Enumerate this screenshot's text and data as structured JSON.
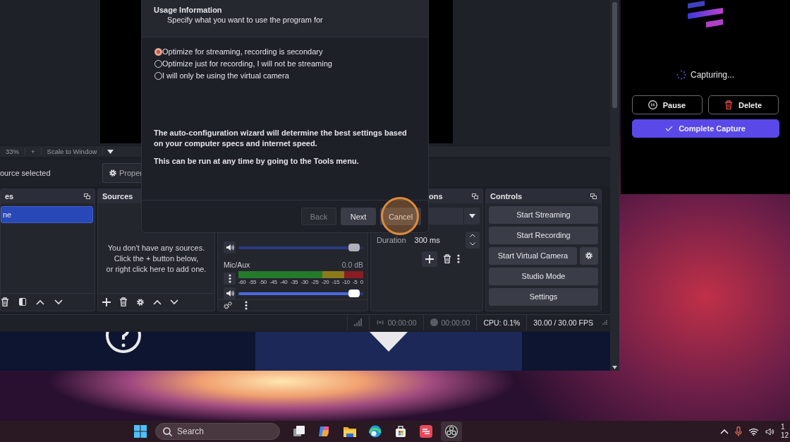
{
  "obs": {
    "preview_bar": {
      "zoom": "33%",
      "plus": "+",
      "scale": "Scale to Window"
    },
    "source_toolbar": {
      "label": "ource selected",
      "properties": "Proper"
    },
    "scenes": {
      "title": "es",
      "items": [
        {
          "name": "ne",
          "selected": true
        }
      ]
    },
    "sources": {
      "title": "Sources",
      "empty_lines": [
        "You don't have any sources.",
        "Click the + button below,",
        "or right click here to add one."
      ]
    },
    "audio_mixer": {
      "tracks": [
        {
          "kind": "slider",
          "level": 0.97,
          "disabled": true
        },
        {
          "kind": "meter",
          "name": "Mic/Aux",
          "reading": "0.0 dB",
          "ticks": [
            "-60",
            "-55",
            "-50",
            "-45",
            "-40",
            "-35",
            "-30",
            "-25",
            "-20",
            "-15",
            "-10",
            "-5",
            "0"
          ],
          "level": 0.97,
          "disabled": false
        }
      ]
    },
    "transitions": {
      "title": "ons",
      "duration_label": "Duration",
      "duration": "300 ms"
    },
    "controls": {
      "title": "Controls",
      "buttons": [
        {
          "label": "Start Streaming",
          "kind": "plain"
        },
        {
          "label": "Start Recording",
          "kind": "plain"
        },
        {
          "label": "Start Virtual Camera",
          "kind": "with-settings"
        },
        {
          "label": "Studio Mode",
          "kind": "plain"
        },
        {
          "label": "Settings",
          "kind": "plain"
        }
      ]
    },
    "status_bar": {
      "stream_time": "00:00:00",
      "record_time": "00:00:00",
      "cpu": "CPU: 0.1%",
      "fps": "30.00 / 30.00 FPS"
    }
  },
  "dialog": {
    "title": "Usage Information",
    "subtitle": "Specify what you want to use the program for",
    "options": [
      {
        "label": "Optimize for streaming, recording is secondary",
        "selected": true
      },
      {
        "label": "Optimize just for recording, I will not be streaming",
        "selected": false
      },
      {
        "label": "I will only be using the virtual camera",
        "selected": false
      }
    ],
    "notes": [
      "The auto-configuration wizard will determine the best settings based on your computer specs and internet speed.",
      "This can be run at any time by going to the Tools menu."
    ],
    "buttons": [
      {
        "label": "Back",
        "disabled": true,
        "highlighted": false
      },
      {
        "label": "Next",
        "disabled": false,
        "highlighted": false
      },
      {
        "label": "Cancel",
        "disabled": false,
        "highlighted": true
      }
    ]
  },
  "capture_panel": {
    "status": "Capturing...",
    "buttons": [
      {
        "label": "Pause",
        "kind": "pause"
      },
      {
        "label": "Delete",
        "kind": "delete"
      },
      {
        "label": "Complete Capture",
        "kind": "complete"
      }
    ]
  },
  "taskbar": {
    "search": {
      "placeholder": "Search"
    },
    "apps": [
      {
        "kind": "task-view",
        "selected": false
      },
      {
        "kind": "copilot",
        "selected": false
      },
      {
        "kind": "folder",
        "selected": false
      },
      {
        "kind": "edge",
        "selected": false
      },
      {
        "kind": "store",
        "selected": false
      },
      {
        "kind": "capture",
        "selected": false
      },
      {
        "kind": "obs",
        "selected": true
      }
    ],
    "clock": [
      "1",
      "12"
    ]
  }
}
